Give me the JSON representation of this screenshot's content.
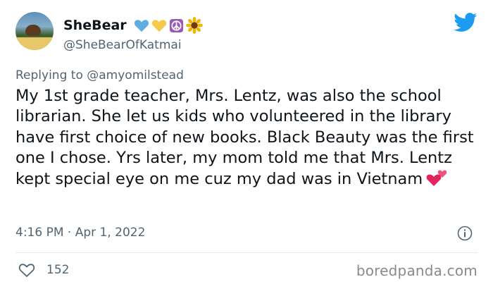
{
  "author": {
    "name": "SheBear",
    "handle": "@SheBearOfKatmai",
    "name_emojis": [
      "blue-heart-icon",
      "yellow-heart-icon",
      "peace-symbol-icon",
      "sunflower-icon"
    ]
  },
  "reply": {
    "prefix": "Replying to",
    "mention": "@amyomilstead"
  },
  "tweet": {
    "text": "My 1st grade teacher, Mrs. Lentz, was also the school librarian. She let us kids who volunteered in the library have first choice of new books. Black Beauty was the first one I chose. Yrs later, my mom told me that Mrs. Lentz kept special eye on me cuz my dad was in Vietnam",
    "trailing_emoji": "two-hearts-icon",
    "timestamp": "4:16 PM · Apr 1, 2022"
  },
  "engagement": {
    "likes": "152"
  },
  "watermark": "boredpanda.com",
  "colors": {
    "text": "#0f1419",
    "secondary": "#536471",
    "twitter_blue": "#1d9bf0",
    "divider": "#e6ecf0"
  }
}
